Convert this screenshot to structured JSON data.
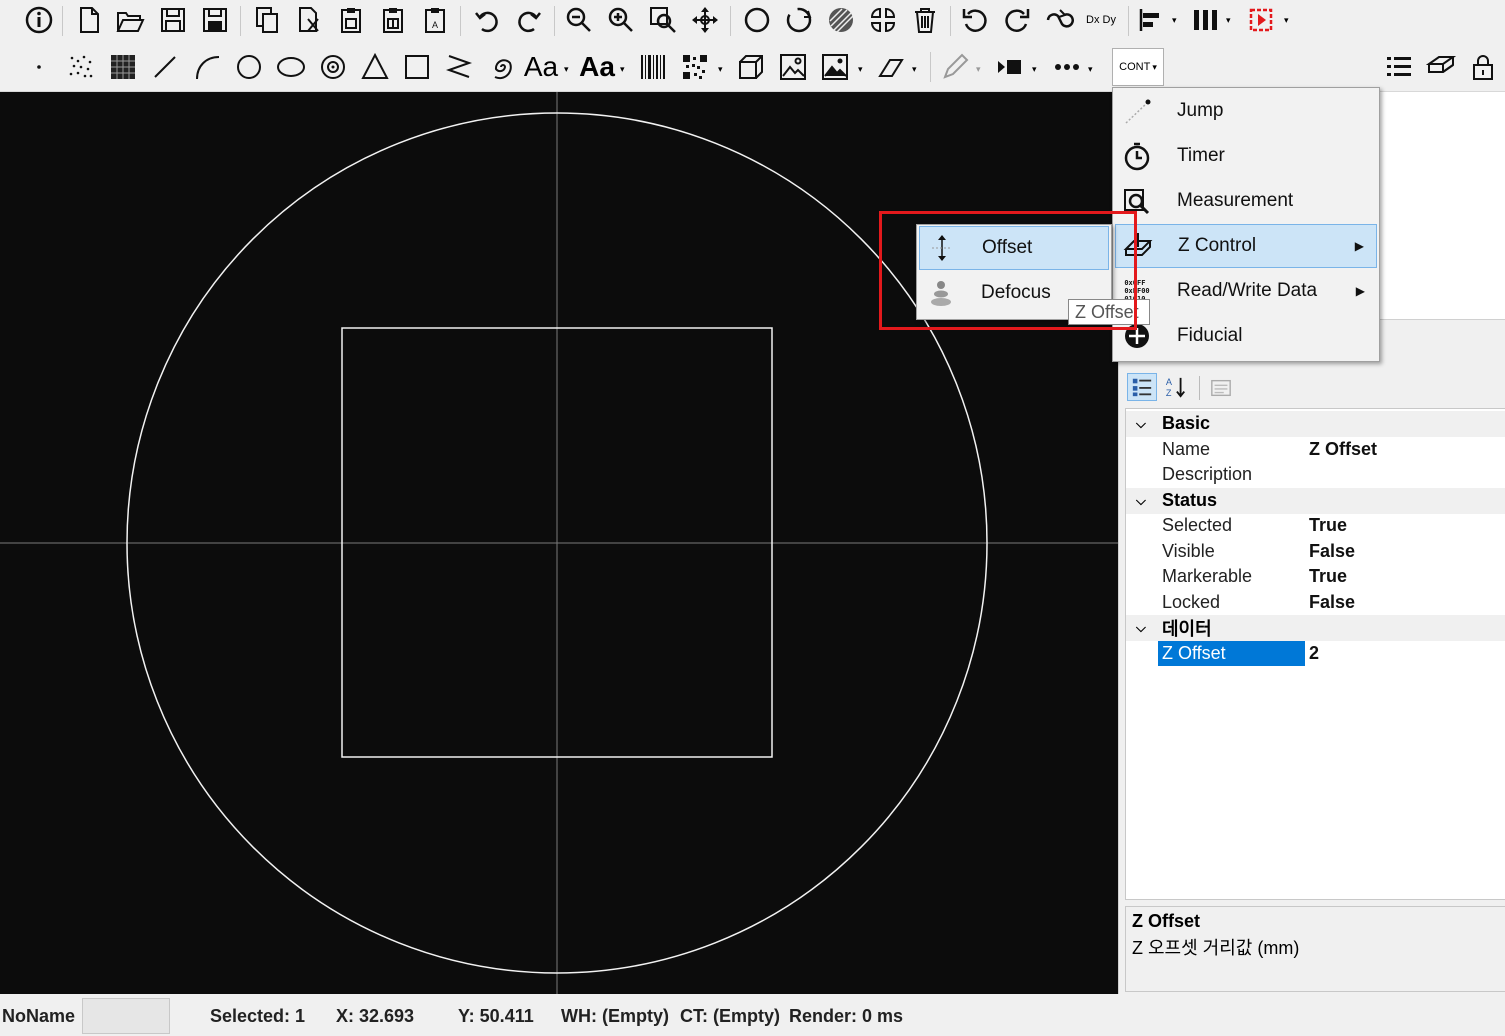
{
  "toolbar_main": {
    "icons": [
      "info-icon",
      "new-file-icon",
      "open-folder-icon",
      "save-icon",
      "save-as-icon",
      "copy-icon",
      "cut-icon",
      "paste-icon",
      "paste-special-icon",
      "paste-array-icon",
      "undo-icon",
      "redo-icon",
      "zoom-out-icon",
      "zoom-in-icon",
      "zoom-window-icon",
      "pan-icon",
      "circle-select-icon",
      "rotate-select-icon",
      "hatch-icon",
      "explode-icon",
      "delete-icon",
      "rotate-ccw-icon",
      "rotate-cw-icon",
      "swap-icon",
      "dxdy-icon",
      "align-left-icon",
      "distribute-icon",
      "stop-icon"
    ],
    "dxdy_label": "Dx Dy"
  },
  "toolbar_draw": {
    "icons": [
      "point-icon",
      "dot-matrix-icon",
      "grid-icon",
      "line-icon",
      "arc-icon",
      "circle-icon",
      "ellipse-icon",
      "spiral-circle-icon",
      "triangle-icon",
      "rectangle-icon",
      "zigzag-icon",
      "spiral-icon",
      "text-icon",
      "bold-text-icon",
      "barcode-icon",
      "qrcode-icon",
      "cube-icon",
      "image-icon",
      "image-array-icon",
      "erase-icon",
      "pen-icon",
      "marker-icon",
      "more-icon",
      "cont-icon",
      "list-icon",
      "layers-icon",
      "lock-icon"
    ],
    "text_label": "Aa",
    "cont_label": "CONT"
  },
  "cont_menu": {
    "items": [
      {
        "label": "Jump",
        "icon": "jump-icon"
      },
      {
        "label": "Timer",
        "icon": "timer-icon"
      },
      {
        "label": "Measurement",
        "icon": "measurement-icon"
      },
      {
        "label": "Z Control",
        "icon": "z-control-icon",
        "submenu": true
      },
      {
        "label": "Read/Write Data",
        "icon": "read-write-data-icon",
        "submenu": true
      },
      {
        "label": "Fiducial",
        "icon": "fiducial-icon"
      }
    ]
  },
  "z_submenu": {
    "items": [
      {
        "label": "Offset",
        "icon": "offset-icon"
      },
      {
        "label": "Defocus",
        "icon": "defocus-icon"
      }
    ],
    "tooltip": "Z Offset"
  },
  "properties": {
    "categories": [
      {
        "name": "Basic",
        "rows": [
          {
            "name": "Name",
            "value": "Z Offset"
          },
          {
            "name": "Description",
            "value": ""
          }
        ]
      },
      {
        "name": "Status",
        "rows": [
          {
            "name": "Selected",
            "value": "True"
          },
          {
            "name": "Visible",
            "value": "False"
          },
          {
            "name": "Markerable",
            "value": "True"
          },
          {
            "name": "Locked",
            "value": "False"
          }
        ]
      },
      {
        "name": "데이터",
        "rows": [
          {
            "name": "Z Offset",
            "value": "2"
          }
        ]
      }
    ],
    "description_title": "Z Offset",
    "description_text": "Z 오프셋 거리값 (mm)"
  },
  "status": {
    "name": "NoName",
    "selected": "Selected: 1",
    "x": "X: 32.693",
    "y": "Y: 50.411",
    "wh": "WH: (Empty)",
    "ct": "CT: (Empty)",
    "render": "Render: 0 ms"
  },
  "colors": {
    "accent": "#0078d7",
    "highlight_bg": "#cce4f7",
    "annotation_red": "#e3191c",
    "canvas_bg": "#0c0c0c"
  }
}
